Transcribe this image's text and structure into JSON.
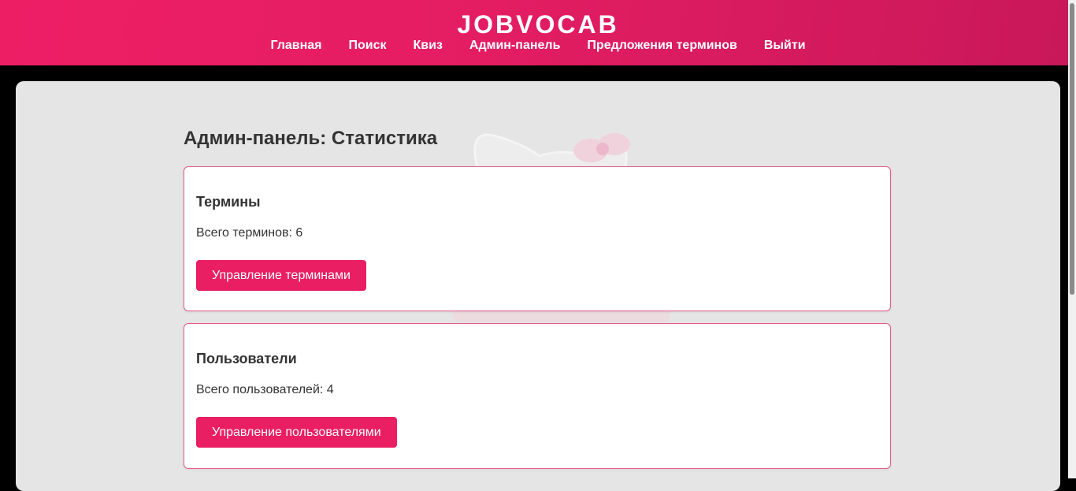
{
  "header": {
    "brand": "JOBVOCAB",
    "nav": [
      {
        "label": "Главная"
      },
      {
        "label": "Поиск"
      },
      {
        "label": "Квиз"
      },
      {
        "label": "Админ-панель"
      },
      {
        "label": "Предложения терминов"
      },
      {
        "label": "Выйти"
      }
    ]
  },
  "main": {
    "title": "Админ-панель: Статистика",
    "cards": {
      "terms": {
        "heading": "Термины",
        "stat": "Всего терминов: 6",
        "button": "Управление терминами"
      },
      "users": {
        "heading": "Пользователи",
        "stat": "Всего пользователей: 4",
        "button": "Управление пользователями"
      }
    }
  },
  "colors": {
    "header_gradient_start": "#ee1e65",
    "header_gradient_end": "#c8185a",
    "accent": "#e91e63",
    "card_border": "#e75a8a",
    "panel_background": "#e5e5e5"
  }
}
